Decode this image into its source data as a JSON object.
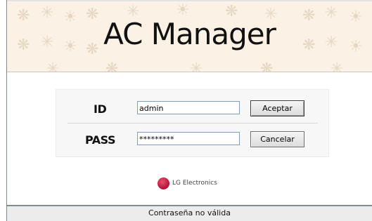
{
  "banner": {
    "title": "AC Manager"
  },
  "login": {
    "id_label": "ID",
    "id_value": "admin",
    "pass_label": "PASS",
    "pass_value": "*********",
    "accept_label": "Aceptar",
    "cancel_label": "Cancelar"
  },
  "brand": {
    "logo_icon": "lg-logo-icon",
    "name": "LG Electronics"
  },
  "status": {
    "message": "Contraseña no válida"
  },
  "colors": {
    "banner_background": "#fbf2e5",
    "banner_motif": "#e6d7c2",
    "panel_background": "#f7f7f7",
    "status_background": "#ececec",
    "brand_red": "#b3103a"
  }
}
